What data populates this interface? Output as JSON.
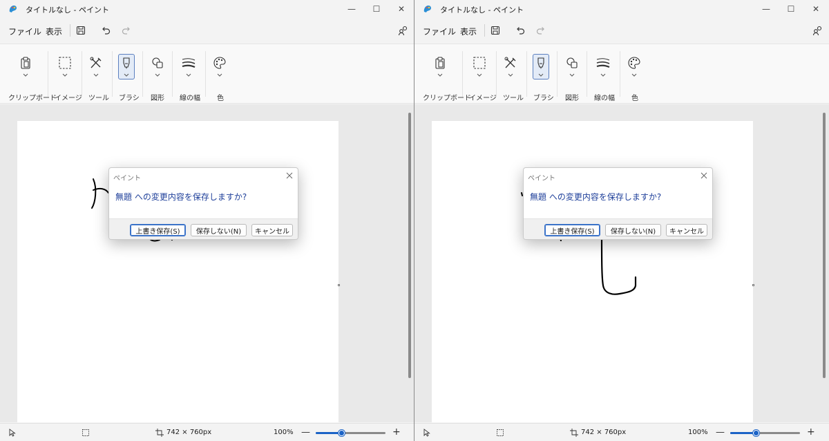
{
  "app": {
    "title": "タイトルなし - ペイント",
    "window_controls": {
      "minimize": "—",
      "maximize": "☐",
      "close": "✕"
    }
  },
  "menu": {
    "file": "ファイル",
    "view": "表示"
  },
  "ribbon": {
    "groups": [
      {
        "label": "クリップボード",
        "icon": "clipboard-icon"
      },
      {
        "label": "イメージ",
        "icon": "selection-icon"
      },
      {
        "label": "ツール",
        "icon": "tools-icon"
      },
      {
        "label": "ブラシ",
        "icon": "brush-icon",
        "selected": true
      },
      {
        "label": "図形",
        "icon": "shapes-icon"
      },
      {
        "label": "線の幅",
        "icon": "line-width-icon"
      },
      {
        "label": "色",
        "icon": "palette-icon"
      }
    ]
  },
  "statusbar": {
    "dimensions": "742 × 760px",
    "zoom": "100%",
    "zoom_level": 0.38,
    "zoom_minus": "—",
    "zoom_plus": "+"
  },
  "dialog": {
    "title": "ペイント",
    "message": "無題 への変更内容を保存しますか?",
    "buttons": {
      "overwrite": "上書き保存(S)",
      "dont_save": "保存しない(N)",
      "cancel": "キャンセル"
    }
  },
  "colors": {
    "accent": "#1b63c6",
    "dialog_text": "#1e3f9a",
    "canvas": "#ffffff"
  }
}
